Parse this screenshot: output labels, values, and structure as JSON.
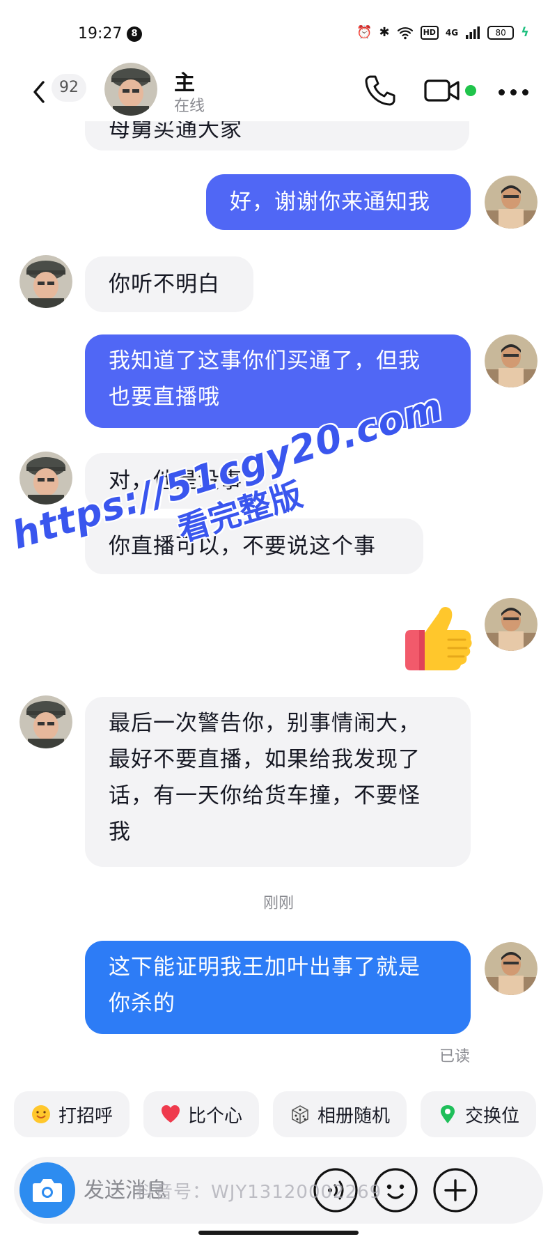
{
  "status_bar": {
    "time": "19:27",
    "notification_count": "8",
    "hd": "HD",
    "network": "4G",
    "battery": "80"
  },
  "header": {
    "back_count": "92",
    "name": "主",
    "status": "在线",
    "online_dot_color": "#20c44b"
  },
  "messages": [
    {
      "side": "received",
      "text": "母舅买通大家",
      "partial": true
    },
    {
      "side": "sent",
      "text": "好，谢谢你来通知我"
    },
    {
      "side": "received",
      "text": "你听不明白"
    },
    {
      "side": "sent",
      "lines": [
        "我知道了这事你们买通了，但我",
        "也要直播哦"
      ]
    },
    {
      "side": "received",
      "text": "对，他是没事"
    },
    {
      "side": "received",
      "text": "你直播可以，不要说这个事"
    },
    {
      "side": "sent",
      "sticker": "thumbs-up"
    },
    {
      "side": "received",
      "lines": [
        "最后一次警告你，别事情闹大，",
        "最好不要直播，如果给我发现了",
        "话，有一天你给货车撞，不要怪",
        "我"
      ]
    },
    {
      "side": "sent",
      "lines": [
        "这下能证明我王加叶出事了就是",
        "你杀的"
      ]
    }
  ],
  "timestamp": "刚刚",
  "read_receipt": "已读",
  "watermark": {
    "url": "https://51cgy20.com",
    "subtitle": "看完整版"
  },
  "quick_chips": [
    {
      "label": "打招呼",
      "icon": "wave-emoji-icon"
    },
    {
      "label": "比个心",
      "icon": "heart-icon"
    },
    {
      "label": "相册随机",
      "icon": "dice-icon"
    },
    {
      "label": "交换位",
      "icon": "location-pin-icon"
    }
  ],
  "input": {
    "placeholder": "发送消息"
  },
  "platform_watermark": "抖音号：WJY13120002269",
  "colors": {
    "sent_bubble": "#5067f5",
    "sent_bubble_latest": "#2d7cf6",
    "received_bubble": "#f3f3f5",
    "camera_button": "#2d8cf0"
  }
}
